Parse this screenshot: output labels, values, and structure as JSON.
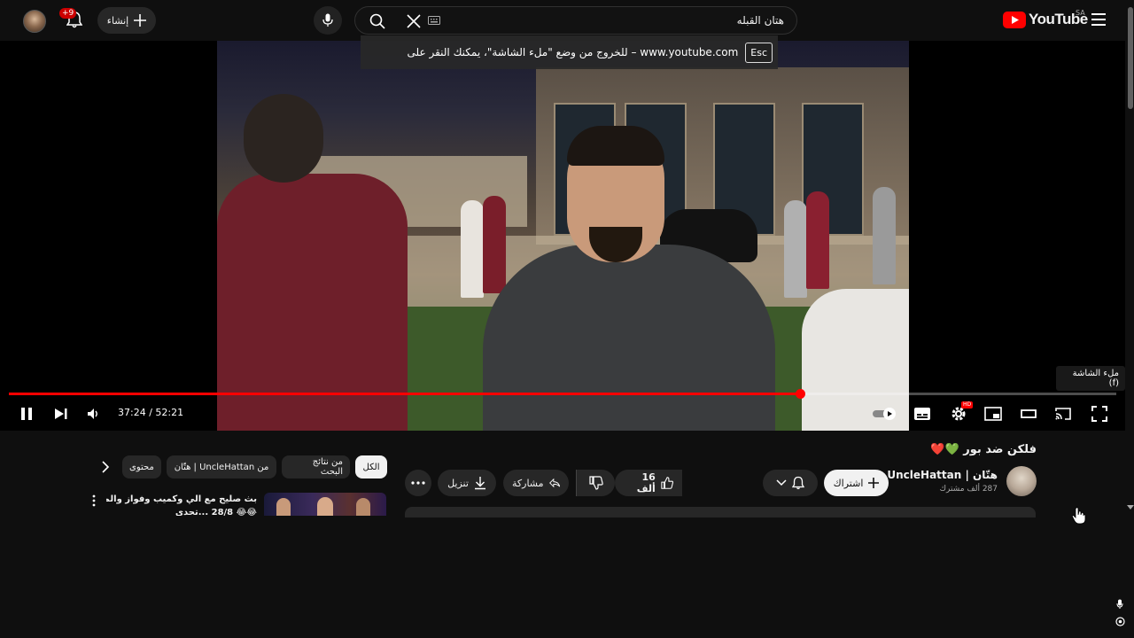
{
  "header": {
    "logo_text": "YouTube",
    "region": "SA",
    "search_value": "هتان القبله",
    "create_label": "إنشاء",
    "notifications_badge": "+9"
  },
  "player": {
    "fullscreen_notice": "www.youtube.com – للخروج من وضع \"ملء الشاشة\"، يمكنك النقر على",
    "esc_label": "Esc",
    "fullscreen_tooltip": "ملء الشاشة (f)",
    "current_time": "37:24",
    "duration": "52:21",
    "time_display": "37:24 / 52:21",
    "progress_fraction": 0.714,
    "hd_badge": "HD"
  },
  "video_info": {
    "title": "فلكن ضد بور 💚❤️",
    "channel_name": "هتّان | UncleHattan",
    "subscribers": "287 ألف مشترك",
    "subscribe_label": "اشتراك",
    "like_count": "16 ألف",
    "share_label": "مشاركة",
    "download_label": "تنزيل"
  },
  "related": {
    "chips": [
      "الكل",
      "من نتائج البحث",
      "من UncleHattan | هتّان",
      "محتوى"
    ],
    "items": [
      {
        "title_line1": "بث صليح مع الي وكميب وفواز والمكسيكي",
        "title_line2": "😂😂 28/8 ...تحدي"
      }
    ]
  },
  "colors": {
    "youtube_red": "#ff0000",
    "background": "#0f0f0f",
    "pill_bg": "#272727"
  }
}
